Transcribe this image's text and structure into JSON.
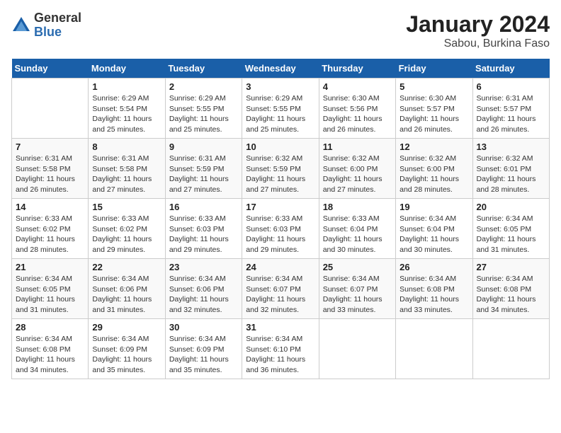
{
  "header": {
    "logo_general": "General",
    "logo_blue": "Blue",
    "title": "January 2024",
    "subtitle": "Sabou, Burkina Faso"
  },
  "columns": [
    "Sunday",
    "Monday",
    "Tuesday",
    "Wednesday",
    "Thursday",
    "Friday",
    "Saturday"
  ],
  "weeks": [
    [
      {
        "day": "",
        "text": ""
      },
      {
        "day": "1",
        "text": "Sunrise: 6:29 AM\nSunset: 5:54 PM\nDaylight: 11 hours\nand 25 minutes."
      },
      {
        "day": "2",
        "text": "Sunrise: 6:29 AM\nSunset: 5:55 PM\nDaylight: 11 hours\nand 25 minutes."
      },
      {
        "day": "3",
        "text": "Sunrise: 6:29 AM\nSunset: 5:55 PM\nDaylight: 11 hours\nand 25 minutes."
      },
      {
        "day": "4",
        "text": "Sunrise: 6:30 AM\nSunset: 5:56 PM\nDaylight: 11 hours\nand 26 minutes."
      },
      {
        "day": "5",
        "text": "Sunrise: 6:30 AM\nSunset: 5:57 PM\nDaylight: 11 hours\nand 26 minutes."
      },
      {
        "day": "6",
        "text": "Sunrise: 6:31 AM\nSunset: 5:57 PM\nDaylight: 11 hours\nand 26 minutes."
      }
    ],
    [
      {
        "day": "7",
        "text": "Sunrise: 6:31 AM\nSunset: 5:58 PM\nDaylight: 11 hours\nand 26 minutes."
      },
      {
        "day": "8",
        "text": "Sunrise: 6:31 AM\nSunset: 5:58 PM\nDaylight: 11 hours\nand 27 minutes."
      },
      {
        "day": "9",
        "text": "Sunrise: 6:31 AM\nSunset: 5:59 PM\nDaylight: 11 hours\nand 27 minutes."
      },
      {
        "day": "10",
        "text": "Sunrise: 6:32 AM\nSunset: 5:59 PM\nDaylight: 11 hours\nand 27 minutes."
      },
      {
        "day": "11",
        "text": "Sunrise: 6:32 AM\nSunset: 6:00 PM\nDaylight: 11 hours\nand 27 minutes."
      },
      {
        "day": "12",
        "text": "Sunrise: 6:32 AM\nSunset: 6:00 PM\nDaylight: 11 hours\nand 28 minutes."
      },
      {
        "day": "13",
        "text": "Sunrise: 6:32 AM\nSunset: 6:01 PM\nDaylight: 11 hours\nand 28 minutes."
      }
    ],
    [
      {
        "day": "14",
        "text": "Sunrise: 6:33 AM\nSunset: 6:02 PM\nDaylight: 11 hours\nand 28 minutes."
      },
      {
        "day": "15",
        "text": "Sunrise: 6:33 AM\nSunset: 6:02 PM\nDaylight: 11 hours\nand 29 minutes."
      },
      {
        "day": "16",
        "text": "Sunrise: 6:33 AM\nSunset: 6:03 PM\nDaylight: 11 hours\nand 29 minutes."
      },
      {
        "day": "17",
        "text": "Sunrise: 6:33 AM\nSunset: 6:03 PM\nDaylight: 11 hours\nand 29 minutes."
      },
      {
        "day": "18",
        "text": "Sunrise: 6:33 AM\nSunset: 6:04 PM\nDaylight: 11 hours\nand 30 minutes."
      },
      {
        "day": "19",
        "text": "Sunrise: 6:34 AM\nSunset: 6:04 PM\nDaylight: 11 hours\nand 30 minutes."
      },
      {
        "day": "20",
        "text": "Sunrise: 6:34 AM\nSunset: 6:05 PM\nDaylight: 11 hours\nand 31 minutes."
      }
    ],
    [
      {
        "day": "21",
        "text": "Sunrise: 6:34 AM\nSunset: 6:05 PM\nDaylight: 11 hours\nand 31 minutes."
      },
      {
        "day": "22",
        "text": "Sunrise: 6:34 AM\nSunset: 6:06 PM\nDaylight: 11 hours\nand 31 minutes."
      },
      {
        "day": "23",
        "text": "Sunrise: 6:34 AM\nSunset: 6:06 PM\nDaylight: 11 hours\nand 32 minutes."
      },
      {
        "day": "24",
        "text": "Sunrise: 6:34 AM\nSunset: 6:07 PM\nDaylight: 11 hours\nand 32 minutes."
      },
      {
        "day": "25",
        "text": "Sunrise: 6:34 AM\nSunset: 6:07 PM\nDaylight: 11 hours\nand 33 minutes."
      },
      {
        "day": "26",
        "text": "Sunrise: 6:34 AM\nSunset: 6:08 PM\nDaylight: 11 hours\nand 33 minutes."
      },
      {
        "day": "27",
        "text": "Sunrise: 6:34 AM\nSunset: 6:08 PM\nDaylight: 11 hours\nand 34 minutes."
      }
    ],
    [
      {
        "day": "28",
        "text": "Sunrise: 6:34 AM\nSunset: 6:08 PM\nDaylight: 11 hours\nand 34 minutes."
      },
      {
        "day": "29",
        "text": "Sunrise: 6:34 AM\nSunset: 6:09 PM\nDaylight: 11 hours\nand 35 minutes."
      },
      {
        "day": "30",
        "text": "Sunrise: 6:34 AM\nSunset: 6:09 PM\nDaylight: 11 hours\nand 35 minutes."
      },
      {
        "day": "31",
        "text": "Sunrise: 6:34 AM\nSunset: 6:10 PM\nDaylight: 11 hours\nand 36 minutes."
      },
      {
        "day": "",
        "text": ""
      },
      {
        "day": "",
        "text": ""
      },
      {
        "day": "",
        "text": ""
      }
    ]
  ]
}
